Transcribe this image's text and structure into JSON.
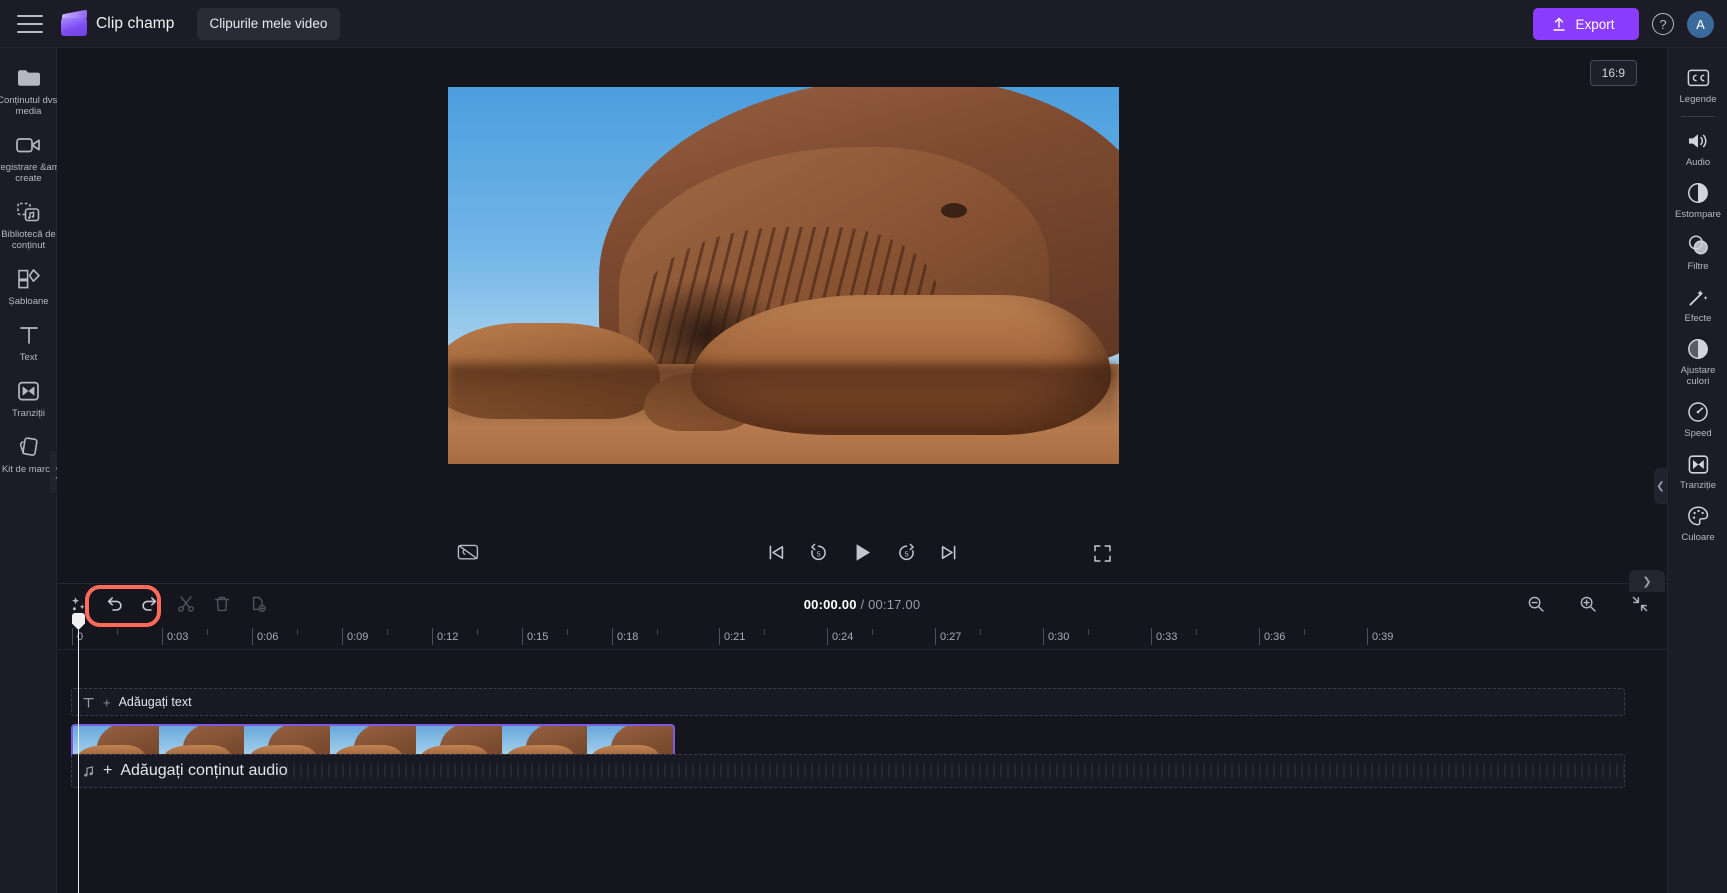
{
  "app": {
    "brand_name": "Clip champ",
    "project_name": "Clipurile mele video",
    "accent_color": "#8B3DFF",
    "highlight_color": "#ff6b5b",
    "avatar_initial": "A"
  },
  "topbar": {
    "menu_icon": "hamburger-icon",
    "logo_icon": "clipchamp-logo-icon",
    "export_label": "Export",
    "export_icon": "upload-icon",
    "help_icon": "help-circle-icon",
    "avatar_label": "A"
  },
  "left_rail": {
    "items": [
      {
        "label": "Conținutul dvs. media",
        "icon": "media-folder-icon"
      },
      {
        "label": "Înregistrare &amp; create",
        "icon": "video-camera-icon"
      },
      {
        "label": "Bibliotecă de conținut",
        "icon": "content-library-icon"
      },
      {
        "label": "Șabloane",
        "icon": "templates-icon"
      },
      {
        "label": "Text",
        "icon": "text-icon"
      },
      {
        "label": "Tranziții",
        "icon": "transitions-icon"
      },
      {
        "label": "Kit de marcă",
        "icon": "brand-kit-icon"
      }
    ],
    "expand_icon": "chevron-right-icon"
  },
  "right_rail": {
    "items": [
      {
        "label": "Legende",
        "icon": "closed-captions-icon"
      },
      {
        "label": "Audio",
        "icon": "speaker-icon"
      },
      {
        "label": "Estompare",
        "icon": "fade-icon"
      },
      {
        "label": "Filtre",
        "icon": "filters-icon"
      },
      {
        "label": "Efecte",
        "icon": "effects-wand-icon"
      },
      {
        "label": "Ajustare culori",
        "icon": "color-adjust-icon"
      },
      {
        "label": "Speed",
        "icon": "speedometer-icon"
      },
      {
        "label": "Tranziție",
        "icon": "transition-icon"
      },
      {
        "label": "Culoare",
        "icon": "palette-icon"
      }
    ]
  },
  "preview": {
    "aspect_ratio": "16:9",
    "ratio_icon": "aspect-ratio-icon",
    "fullscreen_icon": "fullscreen-icon",
    "collapse_icon": "chevron-left-icon",
    "panel_collapse_icon": "chevron-down-icon"
  },
  "player": {
    "captions_icon": "captions-off-icon",
    "skip_back_icon": "skip-to-start-icon",
    "back5_icon": "rewind-5s-icon",
    "play_icon": "play-icon",
    "forward5_icon": "forward-5s-icon",
    "skip_forward_icon": "skip-to-end-icon"
  },
  "timeline_toolbar": {
    "magic_icon": "auto-compose-icon",
    "undo_icon": "undo-icon",
    "redo_icon": "redo-icon",
    "split_icon": "scissors-icon",
    "delete_icon": "trash-icon",
    "duplicate_icon": "duplicate-icon",
    "current_time": "00:00.00",
    "time_separator": "/",
    "total_time": "00:17.00",
    "zoom_out_icon": "zoom-out-icon",
    "zoom_in_icon": "zoom-in-icon",
    "fit_icon": "fit-to-screen-icon"
  },
  "timeline": {
    "ruler_labels": [
      "0",
      "0:03",
      "0:06",
      "0:09",
      "0:12",
      "0:15",
      "0:18",
      "0:21",
      "0:24",
      "0:27",
      "0:30",
      "0:33",
      "0:36",
      "0:39"
    ],
    "ruler_step_seconds": 3,
    "playhead_time": "00:00.00",
    "text_track": {
      "icon": "text-track-icon",
      "plus": "+",
      "label": "Adăugați text"
    },
    "audio_track": {
      "icon": "music-note-icon",
      "plus": "+",
      "label": "Adăugați conținut audio"
    },
    "video_clip": {
      "name": "video-clip",
      "thumbnail_count": 7,
      "border_color": "#7d5ae0"
    }
  }
}
